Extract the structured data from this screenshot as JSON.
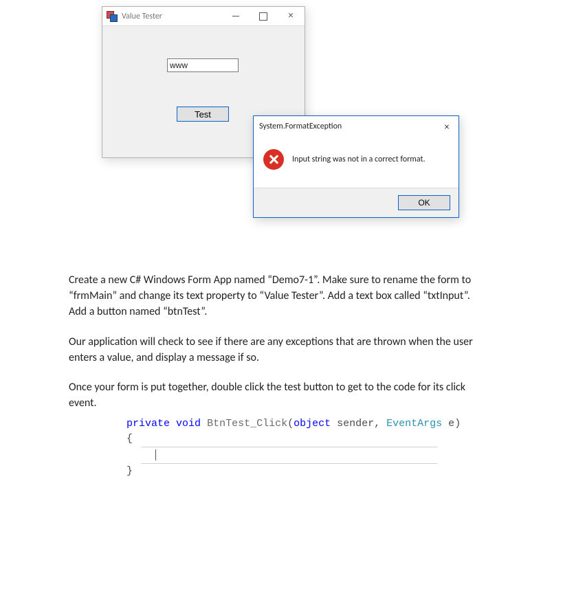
{
  "window": {
    "title": "Value Tester",
    "textbox_value": "www",
    "test_button_label": "Test"
  },
  "dialog": {
    "title": "System.FormatException",
    "message": "Input string was not in a correct format.",
    "ok_label": "OK"
  },
  "doc": {
    "p1": "Create a new C# Windows Form App named “Demo7-1”. Make sure to rename the form to “frmMain” and change its text property to “Value Tester”. Add a text box called “txtInput”. Add a button named “btnTest”.",
    "p2": "Our application will check to see if there are any exceptions that are thrown when the user enters a value, and display a message if so.",
    "p3": "Once your form is put together, double click the test button to get to the code for its click event."
  },
  "code": {
    "kw_private": "private",
    "kw_void": "void",
    "method": "BtnTest_Click",
    "paren_open": "(",
    "kw_object": "object",
    "param1": " sender",
    "comma": ", ",
    "type_eventargs": "EventArgs",
    "param2": " e",
    "paren_close": ")",
    "brace_open": "{",
    "brace_close": "}"
  }
}
